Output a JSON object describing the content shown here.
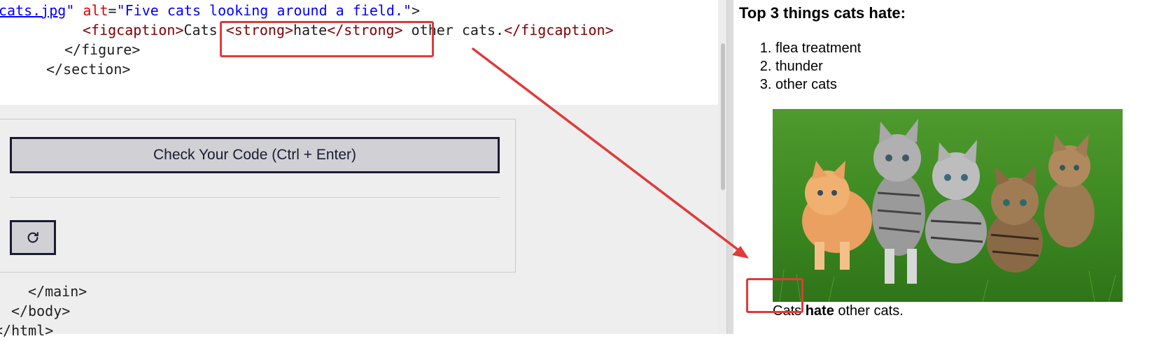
{
  "editor": {
    "line1": {
      "src": "cats.jpg",
      "q1": "\"",
      "attr": " alt",
      "eq": "=",
      "alt_value": "\"Five cats looking around a field.\"",
      "close": ">"
    },
    "line2": {
      "open": "<figcaption>",
      "text_before": "Cats ",
      "strong_open": "<strong>",
      "strong_text": "hate",
      "strong_close": "</strong>",
      "text_after": " other cats.",
      "close": "</figcaption>"
    },
    "line3": "</figure>",
    "line4": "</section>",
    "line5": "</main>",
    "line6": "</body>",
    "line7": "</html>"
  },
  "controls": {
    "check_label": "Check Your Code (Ctrl + Enter)",
    "reset_icon": "reset-icon"
  },
  "preview": {
    "heading": "Top 3 things cats hate:",
    "list": [
      "flea treatment",
      "thunder",
      "other cats"
    ],
    "image_alt": "Five cats looking around a field.",
    "caption_before": "Cats ",
    "caption_strong": "hate",
    "caption_after": " other cats."
  },
  "colors": {
    "annotation_red": "#e03a3a",
    "tag": "#800000",
    "attr": "#e50000",
    "string": "#0000ff",
    "button_bg": "#d0d0d5",
    "button_border": "#1b1b32"
  }
}
